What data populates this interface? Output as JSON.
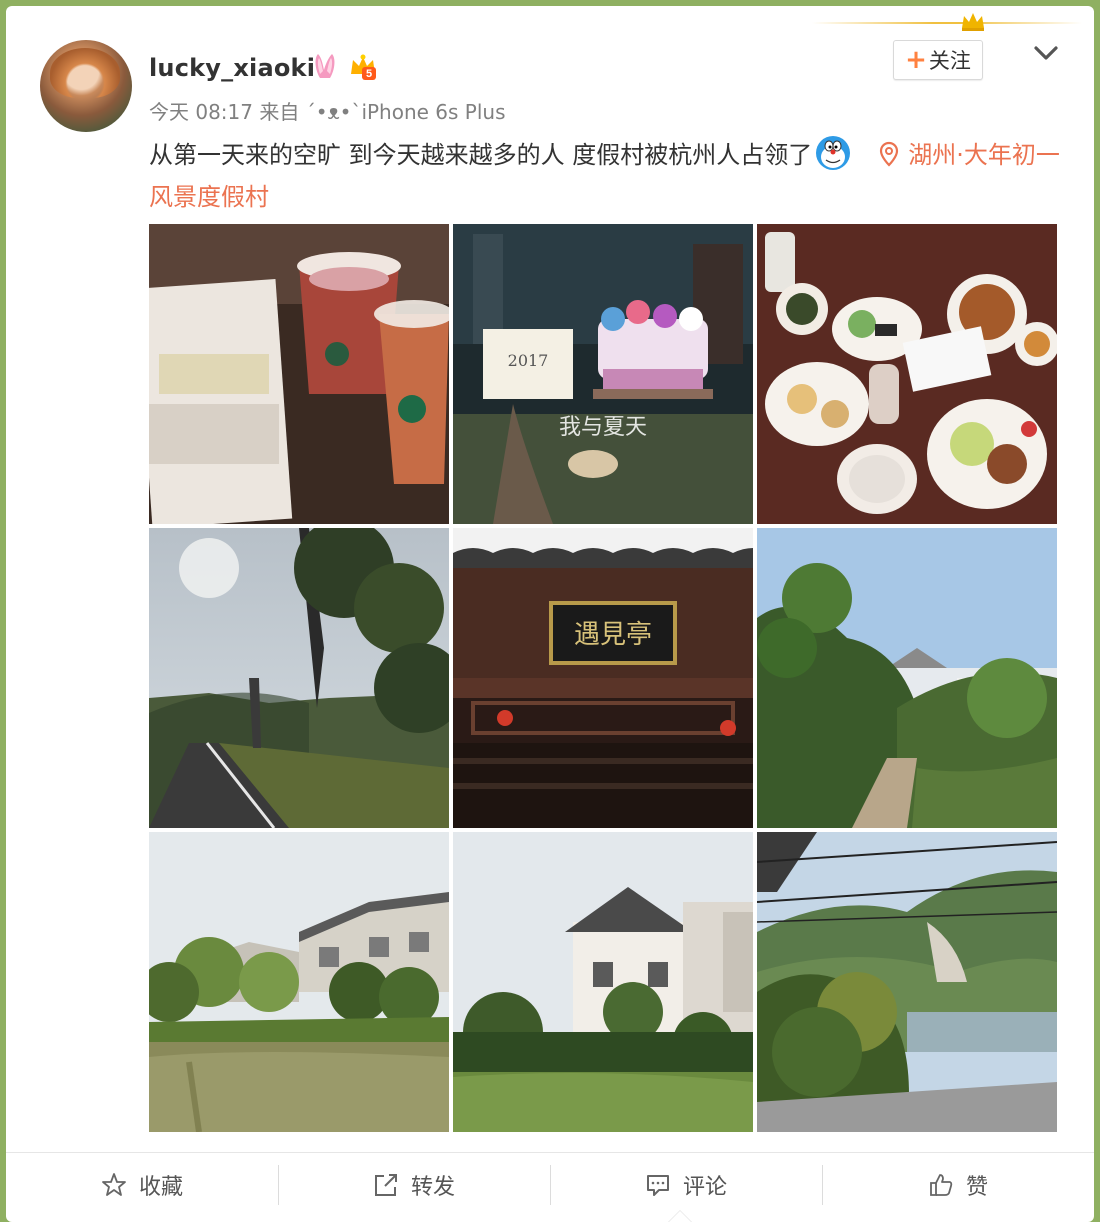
{
  "post": {
    "username": "lucky_xiaoki",
    "meta": "今天 08:17 来自 ´•ᴥ•`iPhone 6s Plus",
    "text": "从第一天来的空旷 到今天越来越多的人 度假村被杭州人占领了",
    "location": "湖州·大年初一风景度假村"
  },
  "follow": {
    "label": "关注"
  },
  "photos": [
    {
      "name": "photo-starbucks-drinks",
      "colors": [
        "#3a2a22",
        "#c9b9a8"
      ]
    },
    {
      "name": "photo-2017-cake",
      "colors": [
        "#1e2a2e",
        "#b9a9c6"
      ]
    },
    {
      "name": "photo-breakfast-table",
      "colors": [
        "#5a2a22",
        "#e8e0d6"
      ]
    },
    {
      "name": "photo-road-trees",
      "colors": [
        "#a9b6c0",
        "#3d4a2a"
      ]
    },
    {
      "name": "photo-pavilion-sign",
      "colors": [
        "#2a1a16",
        "#6a4a3a"
      ]
    },
    {
      "name": "photo-garden-path",
      "colors": [
        "#a9c9e6",
        "#3a5a2a"
      ]
    },
    {
      "name": "photo-pond-villas",
      "colors": [
        "#dfe6ea",
        "#6a6a3a"
      ]
    },
    {
      "name": "photo-villa-lawn",
      "colors": [
        "#e6eaee",
        "#3e5a2e"
      ]
    },
    {
      "name": "photo-mountain-view",
      "colors": [
        "#c6d8e6",
        "#4a6a3a"
      ]
    }
  ],
  "actions": [
    {
      "label": "收藏",
      "icon": "star-icon"
    },
    {
      "label": "转发",
      "icon": "share-icon"
    },
    {
      "label": "评论",
      "icon": "comment-icon"
    },
    {
      "label": "赞",
      "icon": "thumbs-up-icon"
    }
  ],
  "colors": {
    "accent": "#eb7350",
    "follow_plus": "#ff8140",
    "page_bg": "#8fb061"
  }
}
